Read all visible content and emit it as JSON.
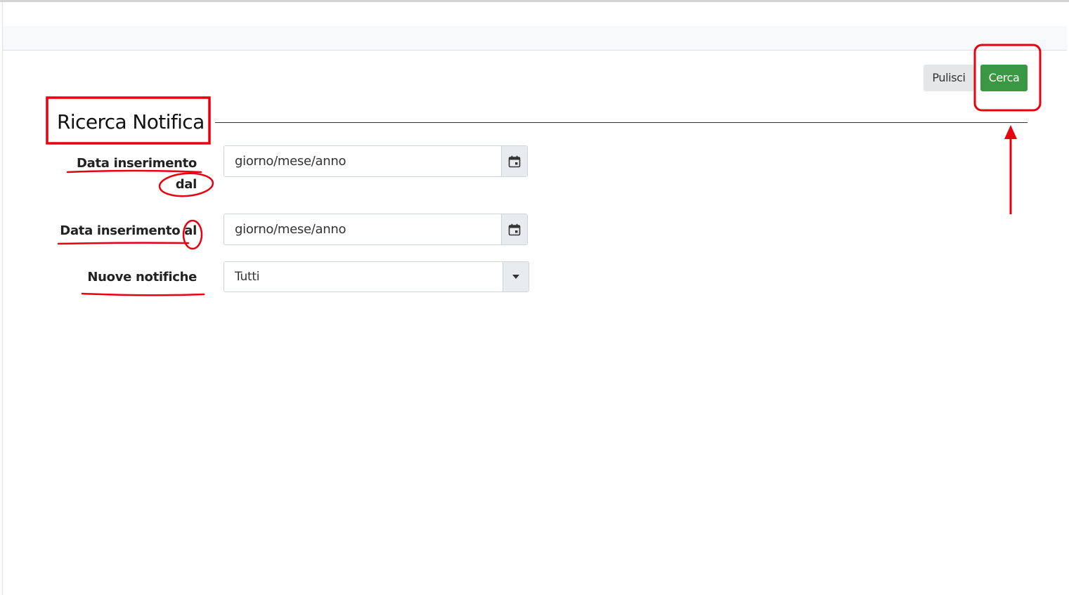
{
  "toolbar": {
    "clear_label": "Pulisci",
    "search_label": "Cerca"
  },
  "form": {
    "title": "Ricerca Notifica",
    "date_from": {
      "label_line1": "Data inserimento",
      "label_line2": "dal",
      "placeholder": "giorno/mese/anno"
    },
    "date_to": {
      "label": "Data inserimento al",
      "placeholder": "giorno/mese/anno"
    },
    "new_notifications": {
      "label": "Nuove notifiche",
      "selected": "Tutti"
    }
  },
  "colors": {
    "search_button": "#3a9743",
    "clear_button": "#e5e6e7",
    "annotation": "#e8000f"
  },
  "icons": {
    "date_picker": "calendar-icon",
    "select_dropdown": "caret-down-icon"
  }
}
